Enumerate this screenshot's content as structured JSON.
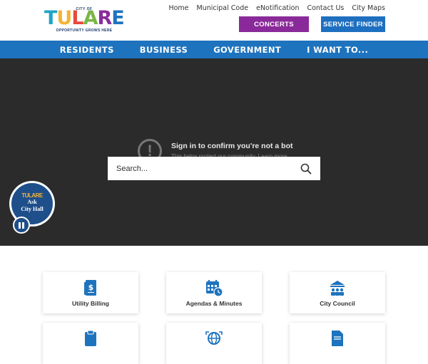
{
  "header": {
    "logo": {
      "top_text": "CITY OF",
      "word": "TULARE",
      "tagline": "OPPORTUNITY GROWS HERE"
    },
    "util_links": [
      "Home",
      "Municipal Code",
      "eNotification",
      "Contact Us",
      "City Maps"
    ],
    "concerts_label": "CONCERTS",
    "service_finder_label": "SERVICE FINDER"
  },
  "nav": {
    "items": [
      "RESIDENTS",
      "BUSINESS",
      "GOVERNMENT",
      "I WANT TO..."
    ]
  },
  "hero": {
    "bot_title": "Sign in to confirm you're not a bot",
    "bot_sub": "This helps protect our community. Learn more",
    "search_placeholder": "Search...",
    "ask": {
      "logo": "TULARE",
      "line1": "Ask",
      "line2": "City Hall"
    }
  },
  "tiles": [
    {
      "label": "Utility Billing",
      "icon": "bill-icon"
    },
    {
      "label": "Agendas & Minutes",
      "icon": "calendar-clock-icon"
    },
    {
      "label": "City Council",
      "icon": "council-icon"
    },
    {
      "label": "",
      "icon": "clipboard-icon"
    },
    {
      "label": "",
      "icon": "globe-icon"
    },
    {
      "label": "",
      "icon": "document-icon"
    }
  ],
  "colors": {
    "nav": "#1e73be",
    "concerts": "#8a2a9a",
    "service": "#1e6fc0",
    "hero": "#2b2b2b",
    "tile_icon": "#1e73be"
  }
}
